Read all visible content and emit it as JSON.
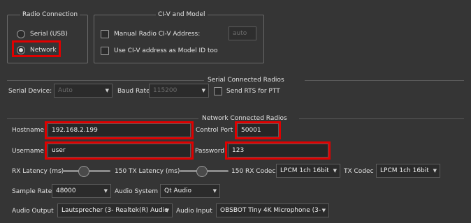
{
  "radio_connection": {
    "legend": "Radio Connection",
    "serial_label": "Serial (USB)",
    "network_label": "Network",
    "selected": "Network"
  },
  "civ_model": {
    "legend": "CI-V and Model",
    "manual_label": "Manual Radio CI-V Address:",
    "manual_value": "auto",
    "use_civ_label": "Use CI-V address as Model ID too"
  },
  "serial_radios": {
    "legend": "Serial Connected Radios",
    "device_label": "Serial Device:",
    "device_value": "Auto",
    "baud_label": "Baud Rate",
    "baud_value": "115200",
    "rts_label": "Send RTS for PTT"
  },
  "network_radios": {
    "legend": "Network Connected Radios",
    "hostname_label": "Hostname",
    "hostname_value": "192.168.2.199",
    "control_port_label": "Control Port",
    "control_port_value": "50001",
    "username_label": "Username",
    "username_value": "user",
    "password_label": "Password",
    "password_value": "123",
    "rx_latency_label": "RX Latency (ms)",
    "rx_latency_value": "150",
    "rx_latency_level": 0.45,
    "tx_latency_label": "TX Latency (ms)",
    "tx_latency_value": "150",
    "tx_latency_level": 0.45,
    "rx_codec_label": "RX Codec",
    "rx_codec_value": "LPCM 1ch 16bit",
    "tx_codec_label": "TX Codec",
    "tx_codec_value": "LPCM 1ch 16bit",
    "sample_rate_label": "Sample Rate",
    "sample_rate_value": "48000",
    "audio_system_label": "Audio System",
    "audio_system_value": "Qt Audio",
    "audio_output_label": "Audio Output",
    "audio_output_value": "Lautsprecher (3- Realtek(R) Audio",
    "audio_input_label": "Audio Input",
    "audio_input_value": "OBSBOT Tiny 4K Microphone (3-"
  },
  "colors": {
    "highlight": "#e00000",
    "background": "#353535"
  },
  "icons": {
    "dropdown": "chevron-down-icon"
  }
}
